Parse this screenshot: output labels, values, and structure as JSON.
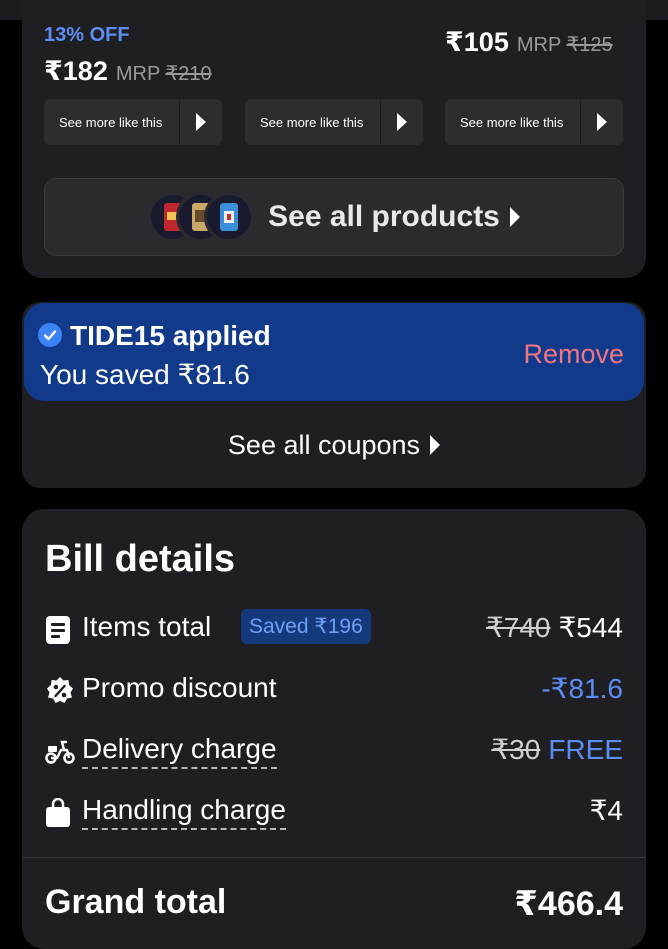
{
  "products": {
    "items": [
      {
        "discount": "13% OFF",
        "price": "₹182",
        "mrp_label": "MRP",
        "mrp": "₹210",
        "see_more": "See more like this"
      },
      {
        "discount": "",
        "price": "",
        "mrp_label": "",
        "mrp": "",
        "see_more": "See more like this"
      },
      {
        "discount": "",
        "price": "₹105",
        "mrp_label": "MRP",
        "mrp": "₹125",
        "see_more": "See more like this"
      }
    ],
    "see_all_label": "See all products"
  },
  "coupon": {
    "code_label": "TIDE15 applied",
    "saved_label": "You saved ₹81.6",
    "remove_label": "Remove",
    "see_all_label": "See all coupons"
  },
  "bill": {
    "title": "Bill details",
    "items_total": {
      "label": "Items total",
      "badge": "Saved ₹196",
      "original": "₹740",
      "value": "₹544"
    },
    "promo_discount": {
      "label": "Promo discount",
      "value": "-₹81.6"
    },
    "delivery_charge": {
      "label": "Delivery charge",
      "original": "₹30",
      "value": "FREE"
    },
    "handling_charge": {
      "label": "Handling charge",
      "value": "₹4"
    },
    "grand_total": {
      "label": "Grand total",
      "value": "₹466.4"
    }
  },
  "colors": {
    "accent_blue": "#5c8df2",
    "coupon_bg": "#123a8a",
    "remove_red": "#f07585",
    "card_bg": "#1f1f23"
  }
}
